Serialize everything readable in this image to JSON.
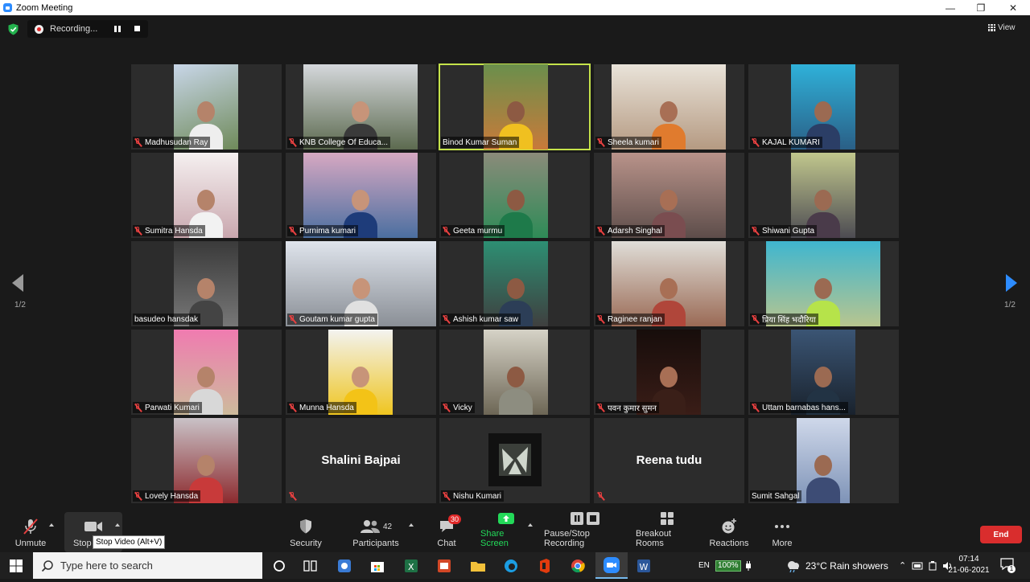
{
  "window": {
    "title": "Zoom Meeting"
  },
  "recording": {
    "label": "Recording..."
  },
  "view": {
    "label": "View"
  },
  "participants_grid": {
    "page_indicator": "1/2",
    "tiles": [
      {
        "name": "Madhusudan Ray",
        "muted": true
      },
      {
        "name": "KNB College Of Educa...",
        "muted": true
      },
      {
        "name": "Binod Kumar Suman",
        "muted": false,
        "active_speaker": true
      },
      {
        "name": "Sheela kumari",
        "muted": true
      },
      {
        "name": "KAJAL KUMARI",
        "muted": true
      },
      {
        "name": "Sumitra Hansda",
        "muted": true
      },
      {
        "name": "Purnima kumari",
        "muted": true
      },
      {
        "name": "Geeta murmu",
        "muted": true
      },
      {
        "name": "Adarsh Singhal",
        "muted": true
      },
      {
        "name": "Shiwani Gupta",
        "muted": true
      },
      {
        "name": "basudeo hansdak",
        "muted": false
      },
      {
        "name": "Goutam kumar gupta",
        "muted": true
      },
      {
        "name": "Ashish kumar saw",
        "muted": true
      },
      {
        "name": "Raginee ranjan",
        "muted": true
      },
      {
        "name": "प्रिया सिंह भदौरिया",
        "muted": true
      },
      {
        "name": "Parwati Kumari",
        "muted": true
      },
      {
        "name": "Munna Hansda",
        "muted": true
      },
      {
        "name": "Vicky",
        "muted": true
      },
      {
        "name": "पवन कुमार सुमन",
        "muted": true
      },
      {
        "name": "Uttam barnabas hans...",
        "muted": true
      },
      {
        "name": "Lovely Hansda",
        "muted": true
      },
      {
        "name": "Shalini Bajpai",
        "muted": true,
        "video_off": true
      },
      {
        "name": "Nishu Kumari",
        "muted": true
      },
      {
        "name": "Reena tudu",
        "muted": true,
        "video_off": true
      },
      {
        "name": "Sumit Sahgal",
        "muted": false
      }
    ]
  },
  "toolbar": {
    "unmute": "Unmute",
    "stop_video": "Stop",
    "stop_video_tooltip": "Stop Video (Alt+V)",
    "security": "Security",
    "participants": "Participants",
    "participants_count": "42",
    "chat": "Chat",
    "chat_badge": "30",
    "share_screen": "Share Screen",
    "pause_stop_recording": "Pause/Stop Recording",
    "breakout_rooms": "Breakout Rooms",
    "reactions": "Reactions",
    "more": "More",
    "end": "End"
  },
  "taskbar": {
    "search_placeholder": "Type here to search",
    "language": "EN",
    "battery": "100%",
    "weather": "23°C  Rain showers",
    "time": "07:14",
    "date": "21-06-2021",
    "notification_count": "1"
  },
  "colors": {
    "background": "#1a1a1a",
    "tile_bg": "#2c2c2c",
    "active_speaker_border": "#c5e34a",
    "muted_red": "#e64040",
    "share_green": "#23d959",
    "zoom_blue": "#2d8cff",
    "end_red": "#d92d2d"
  }
}
